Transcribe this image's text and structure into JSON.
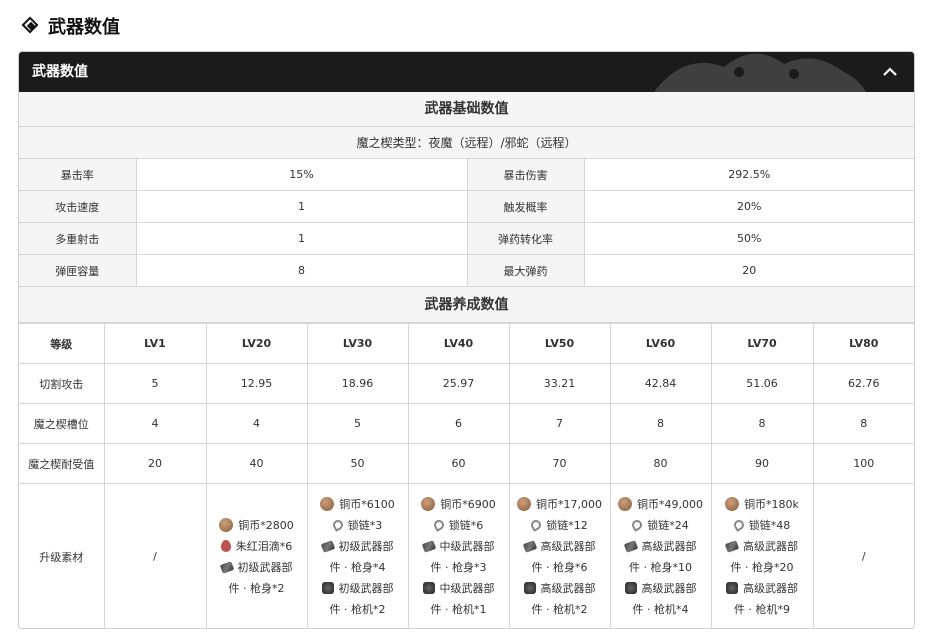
{
  "page": {
    "heading": "武器数值"
  },
  "panel": {
    "title": "武器数值",
    "collapse_icon": "chevron-up-icon",
    "section_base": "武器基础数值",
    "demon_types": "魔之楔类型：夜魔（远程）/邪蛇（远程）",
    "base_rows": [
      {
        "k1": "暴击率",
        "v1": "15%",
        "k2": "暴击伤害",
        "v2": "292.5%"
      },
      {
        "k1": "攻击速度",
        "v1": "1",
        "k2": "触发概率",
        "v2": "20%"
      },
      {
        "k1": "多重射击",
        "v1": "1",
        "k2": "弹药转化率",
        "v2": "50%"
      },
      {
        "k1": "弹匣容量",
        "v1": "8",
        "k2": "最大弹药",
        "v2": "20"
      }
    ],
    "section_growth": "武器养成数值",
    "growth": {
      "header": [
        "等级",
        "LV1",
        "LV20",
        "LV30",
        "LV40",
        "LV50",
        "LV60",
        "LV70",
        "LV80"
      ],
      "rows": [
        [
          "切割攻击",
          "5",
          "12.95",
          "18.96",
          "25.97",
          "33.21",
          "42.84",
          "51.06",
          "62.76"
        ],
        [
          "魔之楔槽位",
          "4",
          "4",
          "5",
          "6",
          "7",
          "8",
          "8",
          "8"
        ],
        [
          "魔之楔耐受值",
          "20",
          "40",
          "50",
          "60",
          "70",
          "80",
          "90",
          "100"
        ]
      ],
      "materials_label": "升级素材",
      "materials": [
        {
          "empty": "/"
        },
        {
          "lines": [
            {
              "icon": "coin-icon",
              "text": "铜币*2800"
            },
            {
              "icon": "tear-icon",
              "text": "朱红泪滴*6"
            },
            {
              "icon": "weapon-part-icon",
              "text": "初级武器部"
            },
            {
              "icon": "",
              "text": "件 · 枪身*2"
            }
          ]
        },
        {
          "lines": [
            {
              "icon": "coin-icon",
              "text": "铜币*6100"
            },
            {
              "icon": "chain-icon",
              "text": "锁链*3"
            },
            {
              "icon": "weapon-part-icon",
              "text": "初级武器部"
            },
            {
              "icon": "",
              "text": "件 · 枪身*4"
            },
            {
              "icon": "trigger-icon",
              "text": "初级武器部"
            },
            {
              "icon": "",
              "text": "件 · 枪机*2"
            }
          ]
        },
        {
          "lines": [
            {
              "icon": "coin-icon",
              "text": "铜币*6900"
            },
            {
              "icon": "chain-icon",
              "text": "锁链*6"
            },
            {
              "icon": "weapon-part-icon",
              "text": "中级武器部"
            },
            {
              "icon": "",
              "text": "件 · 枪身*3"
            },
            {
              "icon": "trigger-icon",
              "text": "中级武器部"
            },
            {
              "icon": "",
              "text": "件 · 枪机*1"
            }
          ]
        },
        {
          "lines": [
            {
              "icon": "coin-icon",
              "text": "铜币*17,000"
            },
            {
              "icon": "chain-icon",
              "text": "锁链*12"
            },
            {
              "icon": "weapon-part-icon",
              "text": "高级武器部"
            },
            {
              "icon": "",
              "text": "件 · 枪身*6"
            },
            {
              "icon": "trigger-icon",
              "text": "高级武器部"
            },
            {
              "icon": "",
              "text": "件 · 枪机*2"
            }
          ]
        },
        {
          "lines": [
            {
              "icon": "coin-icon",
              "text": "铜币*49,000"
            },
            {
              "icon": "chain-icon",
              "text": "锁链*24"
            },
            {
              "icon": "weapon-part-icon",
              "text": "高级武器部"
            },
            {
              "icon": "",
              "text": "件 · 枪身*10"
            },
            {
              "icon": "trigger-icon",
              "text": "高级武器部"
            },
            {
              "icon": "",
              "text": "件 · 枪机*4"
            }
          ]
        },
        {
          "lines": [
            {
              "icon": "coin-icon",
              "text": "铜币*180k"
            },
            {
              "icon": "chain-icon",
              "text": "锁链*48"
            },
            {
              "icon": "weapon-part-icon",
              "text": "高级武器部"
            },
            {
              "icon": "",
              "text": "件 · 枪身*20"
            },
            {
              "icon": "trigger-icon",
              "text": "高级武器部"
            },
            {
              "icon": "",
              "text": "件 · 枪机*9"
            }
          ]
        },
        {
          "empty": "/"
        }
      ]
    }
  }
}
